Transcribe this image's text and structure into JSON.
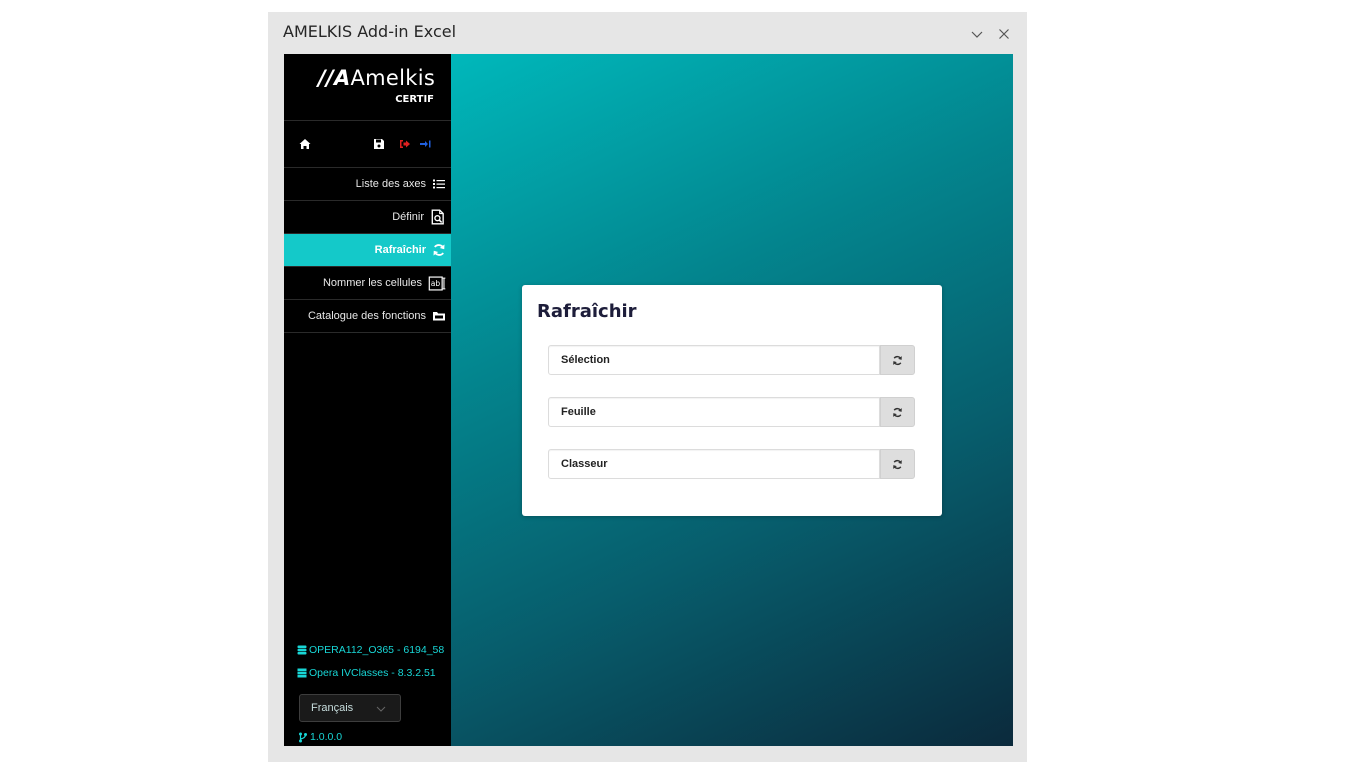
{
  "window": {
    "title": "AMELKIS Add-in Excel"
  },
  "sidebar": {
    "logo_brand": "Amelkis",
    "logo_prefix": "//A",
    "logo_sub": "CERTIF",
    "toolbar_icons": [
      "home-icon",
      "save-icon",
      "sign-out-icon",
      "sign-in-icon"
    ],
    "items": [
      {
        "label": "Liste des axes",
        "icon": "list-icon",
        "active": false
      },
      {
        "label": "Définir",
        "icon": "file-search-icon",
        "active": false
      },
      {
        "label": "Rafraîchir",
        "icon": "refresh-icon",
        "active": true
      },
      {
        "label": "Nommer les cellules",
        "icon": "text-field-icon",
        "active": false
      },
      {
        "label": "Catalogue des fonctions",
        "icon": "folder-icon",
        "active": false
      }
    ],
    "footer": {
      "db1": "OPERA112_O365 - 6194_58",
      "db2": "Opera IVClasses - 8.3.2.51",
      "language": "Français",
      "version": "1.0.0.0"
    }
  },
  "panel": {
    "title": "Rafraîchir",
    "rows": [
      {
        "label": "Sélection"
      },
      {
        "label": "Feuille"
      },
      {
        "label": "Classeur"
      }
    ]
  },
  "colors": {
    "accent": "#14c9c9",
    "sidebar_bg": "#000000",
    "db_text": "#18d6d6",
    "sign_out": "#e02020",
    "sign_in": "#2060e0"
  }
}
